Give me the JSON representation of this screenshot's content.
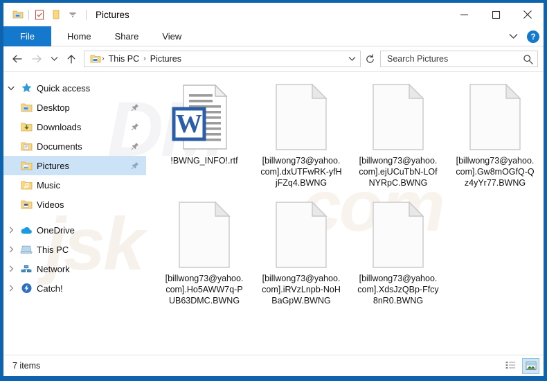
{
  "window": {
    "title": "Pictures",
    "quick_access_toolbar": [
      {
        "icon": "folder-explorer-icon",
        "name": "properties-folder-icon"
      },
      {
        "icon": "properties-checklist-icon",
        "name": "properties-icon"
      },
      {
        "icon": "new-folder-icon",
        "name": "new-folder-icon"
      },
      {
        "icon": "chevron-down-icon",
        "name": "customize-toolbar-icon"
      }
    ],
    "controls": {
      "minimize": "minimize-icon",
      "maximize": "maximize-icon",
      "close": "close-icon"
    }
  },
  "ribbon": {
    "tabs": [
      {
        "label": "File",
        "active": true
      },
      {
        "label": "Home",
        "active": false
      },
      {
        "label": "Share",
        "active": false
      },
      {
        "label": "View",
        "active": false
      }
    ],
    "expand_icon": "chevron-down-icon",
    "help_label": "?",
    "file_tab_color": "#1478cd"
  },
  "navigation": {
    "back_icon": "arrow-left-icon",
    "forward_icon": "arrow-right-icon",
    "recent_icon": "chevron-down-icon",
    "up_icon": "arrow-up-icon",
    "breadcrumb": [
      "This PC",
      "Pictures"
    ],
    "breadcrumb_separator": "›",
    "address_dropdown_icon": "chevron-down-icon",
    "refresh_icon": "refresh-icon"
  },
  "search": {
    "placeholder": "Search Pictures",
    "value": "",
    "icon": "search-icon"
  },
  "sidebar": {
    "items": [
      {
        "label": "Quick access",
        "icon": "star-icon",
        "chevron": "expanded",
        "child": false,
        "pinned": false,
        "selected": false
      },
      {
        "label": "Desktop",
        "icon": "folder-desktop-icon",
        "chevron": "none",
        "child": true,
        "pinned": true,
        "selected": false
      },
      {
        "label": "Downloads",
        "icon": "folder-downloads-icon",
        "chevron": "none",
        "child": true,
        "pinned": true,
        "selected": false
      },
      {
        "label": "Documents",
        "icon": "folder-documents-icon",
        "chevron": "none",
        "child": true,
        "pinned": true,
        "selected": false
      },
      {
        "label": "Pictures",
        "icon": "folder-pictures-icon",
        "chevron": "none",
        "child": true,
        "pinned": true,
        "selected": true
      },
      {
        "label": "Music",
        "icon": "folder-music-icon",
        "chevron": "none",
        "child": true,
        "pinned": false,
        "selected": false
      },
      {
        "label": "Videos",
        "icon": "folder-videos-icon",
        "chevron": "none",
        "child": true,
        "pinned": false,
        "selected": false
      },
      {
        "label": "OneDrive",
        "icon": "cloud-icon",
        "chevron": "collapsed",
        "child": false,
        "pinned": false,
        "selected": false
      },
      {
        "label": "This PC",
        "icon": "computer-icon",
        "chevron": "collapsed",
        "child": false,
        "pinned": false,
        "selected": false
      },
      {
        "label": "Network",
        "icon": "network-icon",
        "chevron": "collapsed",
        "child": false,
        "pinned": false,
        "selected": false
      },
      {
        "label": "Catch!",
        "icon": "catch-icon",
        "chevron": "collapsed",
        "child": false,
        "pinned": false,
        "selected": false
      }
    ]
  },
  "files": [
    {
      "name": "!BWNG_INFO!.rtf",
      "icon": "word-rtf-document-icon"
    },
    {
      "name": "[billwong73@yahoo.com].dxUTFwRK-yfHjFZq4.BWNG",
      "icon": "blank-file-icon"
    },
    {
      "name": "[billwong73@yahoo.com].ejUCuTbN-LOfNYRpC.BWNG",
      "icon": "blank-file-icon"
    },
    {
      "name": "[billwong73@yahoo.com].Gw8mOGfQ-Qz4yYr77.BWNG",
      "icon": "blank-file-icon"
    },
    {
      "name": "[billwong73@yahoo.com].Ho5AWW7q-PUB63DMC.BWNG",
      "icon": "blank-file-icon"
    },
    {
      "name": "[billwong73@yahoo.com].iRVzLnpb-NoHBaGpW.BWNG",
      "icon": "blank-file-icon"
    },
    {
      "name": "[billwong73@yahoo.com].XdsJzQBp-Ffcy8nR0.BWNG",
      "icon": "blank-file-icon"
    }
  ],
  "statusbar": {
    "item_count": "7 items",
    "views": [
      {
        "name": "details-view-button",
        "icon": "details-view-icon",
        "active": false
      },
      {
        "name": "large-icons-view-button",
        "icon": "large-icons-view-icon",
        "active": true
      }
    ]
  },
  "watermarks": [
    "DM",
    "jsk",
    "com"
  ],
  "colors": {
    "window_border": "#0d63ae",
    "accent": "#1478cd",
    "selection": "#cce3f7"
  }
}
